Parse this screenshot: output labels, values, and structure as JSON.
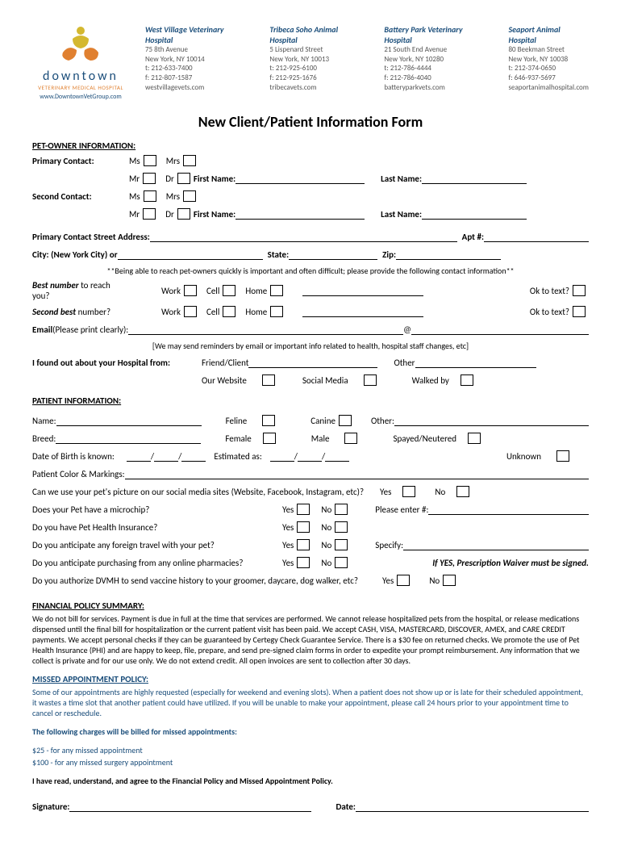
{
  "logo": {
    "brand": "downtown",
    "sub": "VETERINARY MEDICAL HOSPITAL",
    "url": "www.DowntownVetGroup.com"
  },
  "locations": [
    {
      "name": "West Village Veterinary Hospital",
      "addr1": "75 8th Avenue",
      "addr2": "New York, NY 10014",
      "tel": "t: 212-633-7400",
      "fax": "f: 212-807-1587",
      "site": "westvillagevets.com"
    },
    {
      "name": "Tribeca Soho Animal Hospital",
      "addr1": "5 Lispenard Street",
      "addr2": "New York, NY 10013",
      "tel": "t: 212-925-6100",
      "fax": "f: 212-925-1676",
      "site": "tribecavets.com"
    },
    {
      "name": "Battery Park Veterinary Hospital",
      "addr1": "21 South End Avenue",
      "addr2": "New York, NY 10280",
      "tel": "t: 212-786-4444",
      "fax": "f: 212-786-4040",
      "site": "batteryparkvets.com"
    },
    {
      "name": "Seaport Animal Hospital",
      "addr1": "80 Beekman Street",
      "addr2": "New York, NY 10038",
      "tel": "t: 212-374-0650",
      "fax": "f: 646-937-5697",
      "site": "seaportanimalhospital.com"
    }
  ],
  "title": "New Client/Patient Information Form",
  "owner": {
    "head": "PET-OWNER INFORMATION:",
    "primary": "Primary Contact:",
    "second": "Second Contact:",
    "ms": "Ms",
    "mrs": "Mrs",
    "mr": "Mr",
    "dr": "Dr",
    "first": "First Name:",
    "last": "Last Name:",
    "street": "Primary Contact Street Address:",
    "apt": "Apt #:",
    "city": "City: (New York City) or",
    "state": "State:",
    "zip": "Zip:",
    "note": "**Being able to reach pet-owners quickly is important and often difficult; please provide the following contact information**",
    "best": "Best number",
    "reach": " to reach you?",
    "secondbest": "Second best",
    "num": " number?",
    "work": "Work",
    "cell": "Cell",
    "home": "Home",
    "oktext": "Ok to text?",
    "email": "Email",
    "emailp": " (Please print clearly):",
    "at": "@",
    "emailnote": "[We may send reminders by email or important info related to health, hospital staff changes, etc]",
    "found": "I found out about your Hospital from:",
    "friend": "Friend/Client",
    "other": "Other",
    "website": "Our Website",
    "social": "Social Media",
    "walked": "Walked by"
  },
  "patient": {
    "head": "PATIENT INFORMATION:",
    "name": "Name:",
    "feline": "Feline",
    "canine": "Canine",
    "other": "Other:",
    "breed": "Breed:",
    "female": "Female",
    "male": "Male",
    "spayed": "Spayed/Neutered",
    "dob": "Date of Birth is known:",
    "est": "Estimated as:",
    "unknown": "Unknown",
    "slash": "/",
    "color": "Patient Color & Markings:",
    "social_q": "Can we use your pet's picture on our social media sites (Website, Facebook, Instagram, etc)?",
    "yes": "Yes",
    "no": "No",
    "chip_q": "Does your Pet have a microchip?",
    "chip_enter": "Please enter #:",
    "ins_q": "Do you have Pet Health Insurance?",
    "travel_q": "Do you anticipate any foreign travel with your pet?",
    "specify": "Specify:",
    "online_q": "Do you anticipate purchasing from any online pharmacies?",
    "waiver": "If YES, Prescription Waiver must be signed.",
    "vacc_q": "Do you authorize DVMH to send vaccine history to your groomer, daycare, dog walker, etc?"
  },
  "financial": {
    "head": "FINANCIAL POLICY SUMMARY:",
    "body": "We do not bill for services. Payment is due in full at the time that services are performed. We cannot release hospitalized pets from the hospital, or release medications dispensed until the final bill for hospitalization or the current patient visit has been paid. We accept CASH, VISA, MASTERCARD, DISCOVER, AMEX, and CARE CREDIT payments. We accept personal checks if they can be guaranteed by Certegy Check Guarantee Service. There is a $30 fee on returned checks. We promote the use of Pet Health Insurance (PHI) and are happy to keep, file, prepare, and send pre-signed claim forms in order to expedite your prompt reimbursement. Any information that we collect is private and for our use only. We do not extend credit. All open invoices are sent to collection after 30 days."
  },
  "missed": {
    "head": "MISSED APPOINTMENT POLICY:",
    "body": "Some of our appointments are highly requested (especially for weekend and evening slots). When a patient does not show up or is late for their scheduled appointment, it wastes a time slot that another patient could have utilized. If you will be unable to make your appointment, please call 24 hours prior to your appointment time to cancel or reschedule.",
    "charges_head": "The following charges will be billed for missed appointments:",
    "c1": "$25 - for any missed appointment",
    "c2": "$100 - for any missed surgery appointment"
  },
  "agree": "I have read, understand, and agree to the Financial Policy and Missed Appointment Policy.",
  "sig": "Signature:",
  "date": "Date:"
}
